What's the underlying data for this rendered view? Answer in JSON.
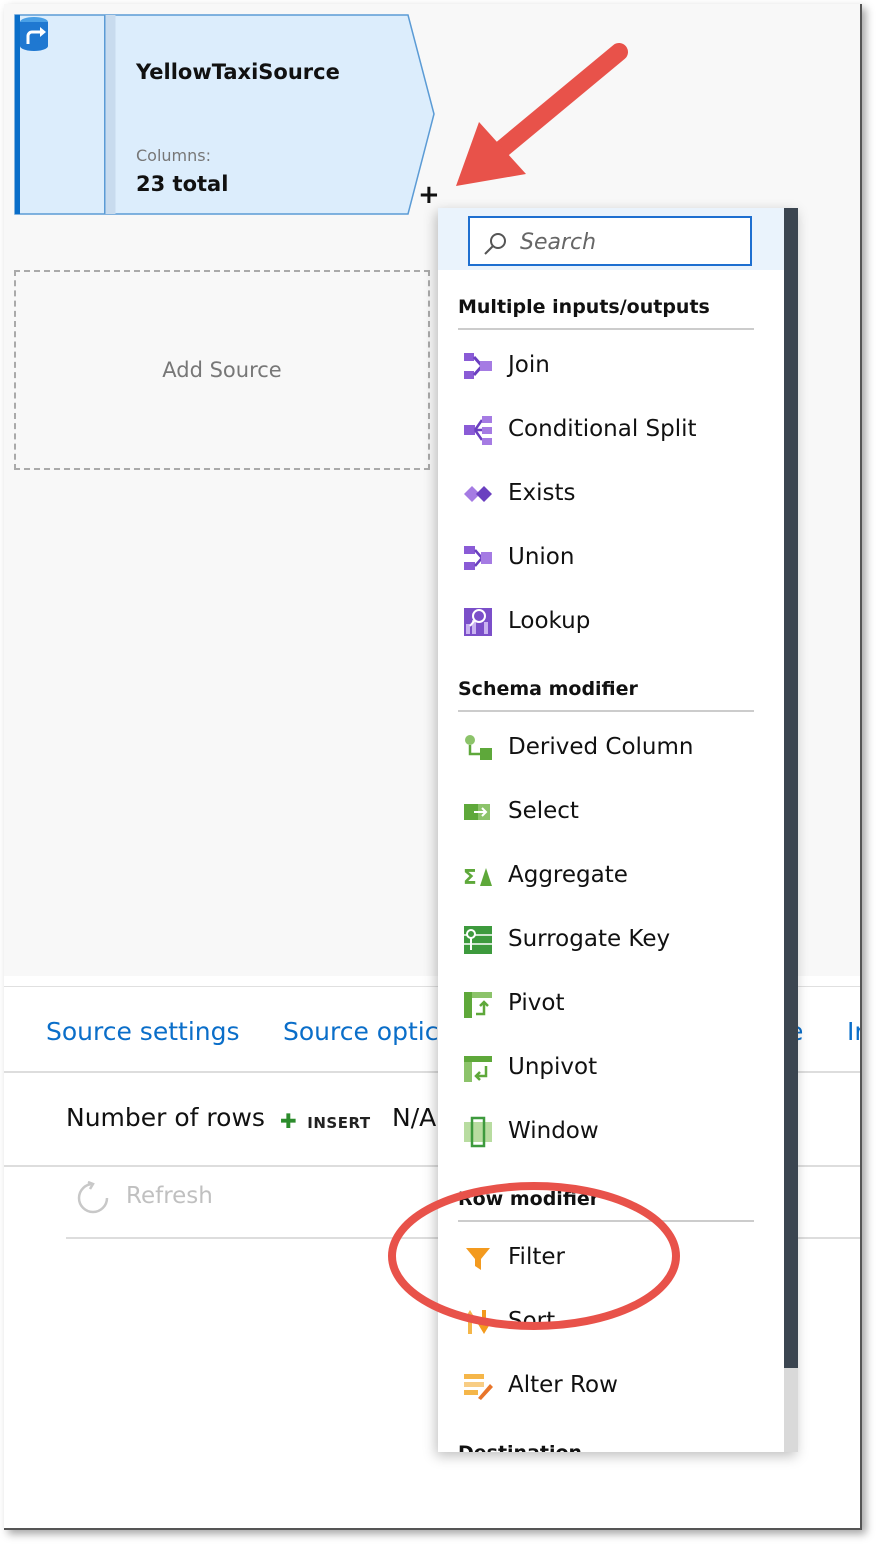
{
  "source_node": {
    "title": "YellowTaxiSource",
    "columns_label": "Columns:",
    "columns_value": "23 total",
    "add_glyph": "+"
  },
  "add_source": {
    "label": "Add Source"
  },
  "bottom_panel": {
    "tabs": [
      "Source settings",
      "Source optic",
      "e",
      "Ir"
    ],
    "rows_label": "Number of rows",
    "insert_label": "INSERT",
    "rows_value": "N/A",
    "refresh_label": "Refresh"
  },
  "menu": {
    "search": {
      "placeholder": "Search"
    },
    "sections": [
      {
        "title": "Multiple inputs/outputs",
        "items": [
          {
            "label": "Join",
            "icon": "join-icon"
          },
          {
            "label": "Conditional Split",
            "icon": "conditional-split-icon"
          },
          {
            "label": "Exists",
            "icon": "exists-icon"
          },
          {
            "label": "Union",
            "icon": "union-icon"
          },
          {
            "label": "Lookup",
            "icon": "lookup-icon"
          }
        ]
      },
      {
        "title": "Schema modifier",
        "items": [
          {
            "label": "Derived Column",
            "icon": "derived-column-icon"
          },
          {
            "label": "Select",
            "icon": "select-icon"
          },
          {
            "label": "Aggregate",
            "icon": "aggregate-icon"
          },
          {
            "label": "Surrogate Key",
            "icon": "surrogate-key-icon"
          },
          {
            "label": "Pivot",
            "icon": "pivot-icon"
          },
          {
            "label": "Unpivot",
            "icon": "unpivot-icon"
          },
          {
            "label": "Window",
            "icon": "window-icon"
          }
        ]
      },
      {
        "title": "Row modifier",
        "items": [
          {
            "label": "Filter",
            "icon": "filter-icon"
          },
          {
            "label": "Sort",
            "icon": "sort-icon"
          },
          {
            "label": "Alter Row",
            "icon": "alter-row-icon"
          }
        ]
      },
      {
        "title": "Destination",
        "items": []
      }
    ]
  },
  "colors": {
    "accent_blue": "#0a6ec9",
    "node_fill": "#dcedfc",
    "annotation_red": "#e8524a",
    "purple_icon": "#7b4fc9",
    "green_icon": "#5ea83a"
  }
}
